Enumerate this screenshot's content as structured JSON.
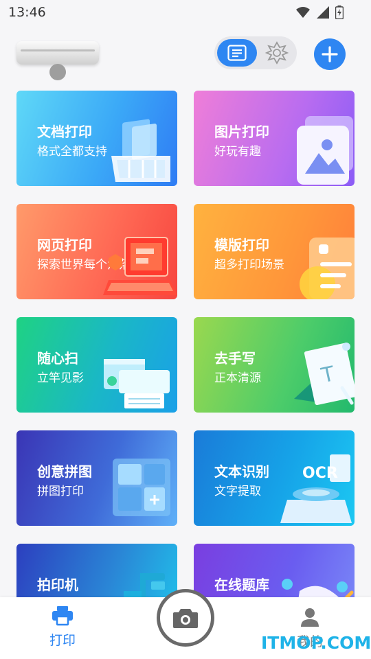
{
  "status": {
    "time": "13:46"
  },
  "colors": {
    "accent": "#2e86f2",
    "nav_active": "#2e86f2",
    "nav_inactive": "#888888"
  },
  "cards": [
    {
      "title": "文档打印",
      "subtitle": "格式全都支持",
      "icon": "document-tray-icon"
    },
    {
      "title": "图片打印",
      "subtitle": "好玩有趣",
      "icon": "image-icon"
    },
    {
      "title": "网页打印",
      "subtitle": "探索世界每个角落",
      "icon": "laptop-web-icon"
    },
    {
      "title": "模版打印",
      "subtitle": "超多打印场景",
      "icon": "template-icon"
    },
    {
      "title": "随心扫",
      "subtitle": "立竿见影",
      "icon": "scanner-icon"
    },
    {
      "title": "去手写",
      "subtitle": "正本清源",
      "icon": "erase-handwriting-icon"
    },
    {
      "title": "创意拼图",
      "subtitle": "拼图打印",
      "icon": "puzzle-icon"
    },
    {
      "title": "文本识别",
      "subtitle": "文字提取",
      "icon": "ocr-icon"
    },
    {
      "title": "拍印机",
      "subtitle": "",
      "icon": "document-camera-icon"
    },
    {
      "title": "在线题库",
      "subtitle": "",
      "icon": "question-bank-icon"
    }
  ],
  "nav": {
    "print_label": "打印",
    "me_label": "我的",
    "camera_icon": "camera-icon"
  },
  "watermark": "ITMOP.COM"
}
